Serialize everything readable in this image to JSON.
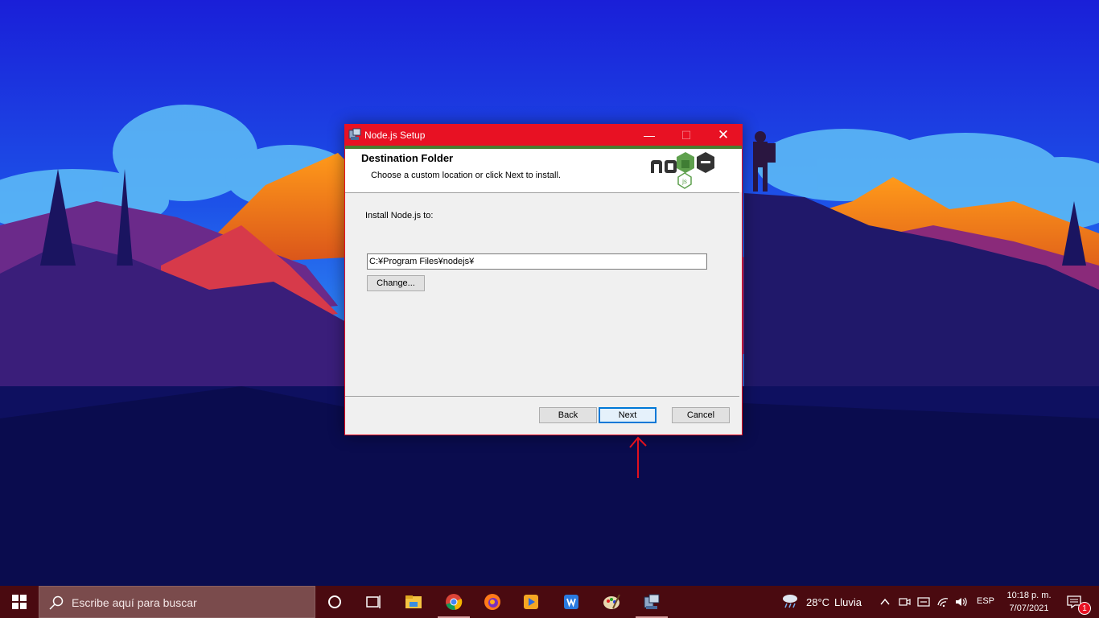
{
  "window": {
    "title": "Node.js Setup",
    "title_bar_color": "#e81123",
    "minimize": "—",
    "maximize": "☐",
    "close": "✕"
  },
  "dialog": {
    "heading": "Destination Folder",
    "subheading": "Choose a custom location or click Next to install.",
    "logo_icon": "nodejs-logo",
    "install_label": "Install Node.js to:",
    "install_path": "C:¥Program Files¥nodejs¥",
    "change_label": "Change...",
    "back_label": "Back",
    "next_label": "Next",
    "cancel_label": "Cancel"
  },
  "taskbar": {
    "search_placeholder": "Escribe aquí para buscar",
    "apps": [
      "cortana-icon",
      "task-view-icon",
      "file-explorer-icon",
      "chrome-icon",
      "firefox-icon",
      "video-editor-icon",
      "wps-office-icon",
      "paint-icon",
      "setup-icon"
    ],
    "weather_temp": "28°C",
    "weather_condition": "Lluvia",
    "language": "ESP",
    "time": "10:18 p. m.",
    "date": "7/07/2021",
    "notification_count": "1"
  }
}
